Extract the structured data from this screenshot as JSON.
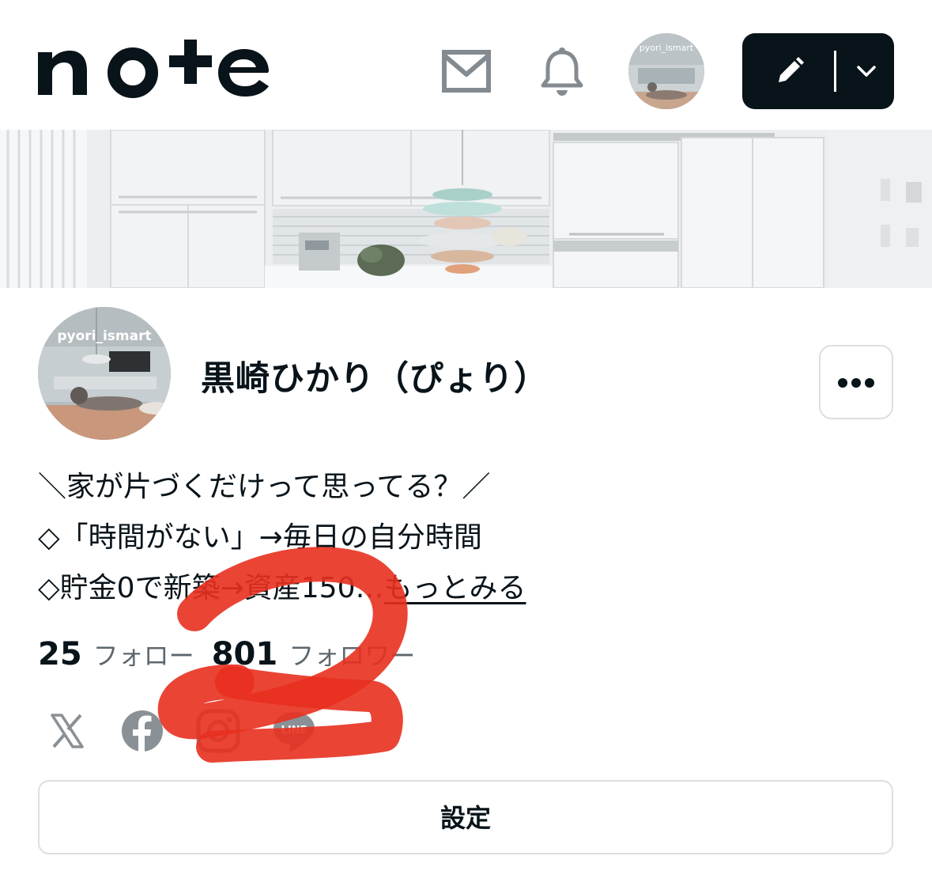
{
  "header": {
    "logo_text": "note",
    "avatar_watermark": "pyori_ismart",
    "icons": [
      "mail-icon",
      "bell-icon",
      "pencil-icon",
      "chevron-down-icon"
    ]
  },
  "profile": {
    "avatar_watermark": "pyori_ismart",
    "name": "黒崎ひかり（ぴょり）",
    "bio_lines": [
      "＼家が片づくだけって思ってる？／",
      "◇「時間がない」→毎日の自分時間",
      "◇貯金0で新築→資産150…"
    ],
    "more_link": "もっとみる",
    "following_count": "25",
    "following_label": "フォロー",
    "followers_count": "801",
    "followers_label": "フォロワー",
    "social_icons": [
      "x-icon",
      "facebook-icon",
      "instagram-icon",
      "line-icon"
    ],
    "line_icon_text": "LINE"
  },
  "actions": {
    "settings_label": "設定"
  },
  "colors": {
    "text_primary": "#08131a",
    "text_secondary": "#5d676d",
    "icon_gray": "#848b90",
    "annotation_red": "#e8301f"
  }
}
